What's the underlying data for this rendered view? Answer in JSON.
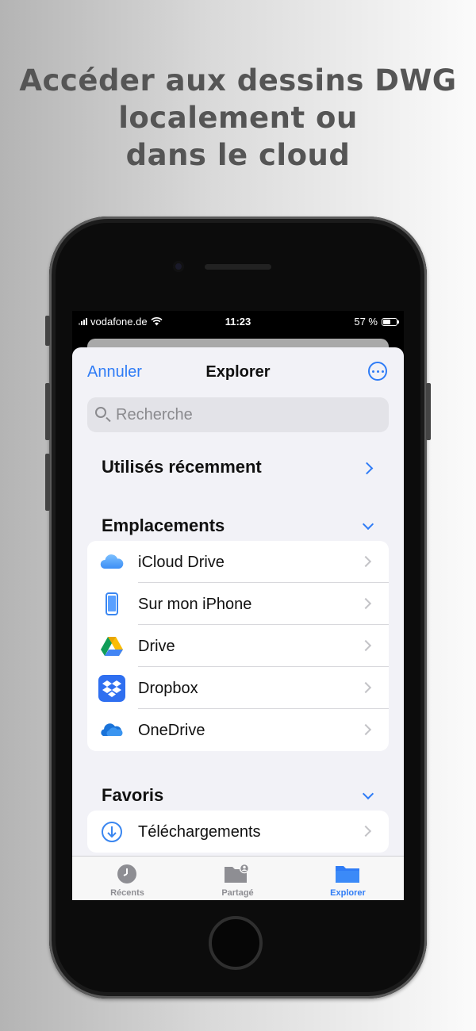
{
  "headline": [
    "Accéder aux dessins DWG",
    "localement ou",
    "dans le cloud"
  ],
  "status_bar": {
    "carrier": "vodafone.de",
    "time": "11:23",
    "battery": "57 %",
    "battery_level": 0.57
  },
  "nav": {
    "cancel": "Annuler",
    "title": "Explorer",
    "more_icon": "ellipsis-circle-icon"
  },
  "search": {
    "placeholder": "Recherche",
    "value": ""
  },
  "recent": {
    "label": "Utilisés récemment"
  },
  "locations": {
    "header": "Emplacements",
    "items": [
      {
        "label": "iCloud Drive",
        "icon": "icloud-icon"
      },
      {
        "label": "Sur mon iPhone",
        "icon": "iphone-icon"
      },
      {
        "label": "Drive",
        "icon": "google-drive-icon"
      },
      {
        "label": "Dropbox",
        "icon": "dropbox-icon"
      },
      {
        "label": "OneDrive",
        "icon": "onedrive-icon"
      }
    ]
  },
  "favorites": {
    "header": "Favoris",
    "items": [
      {
        "label": "Téléchargements",
        "icon": "download-icon"
      }
    ]
  },
  "tabs": [
    {
      "label": "Récents",
      "icon": "clock-icon",
      "active": false
    },
    {
      "label": "Partagé",
      "icon": "shared-folder-icon",
      "active": false
    },
    {
      "label": "Explorer",
      "icon": "folder-icon",
      "active": true
    }
  ],
  "colors": {
    "accent": "#2f7cf6",
    "dropbox": "#2f6ff0",
    "background_light": "#f2f2f7"
  }
}
